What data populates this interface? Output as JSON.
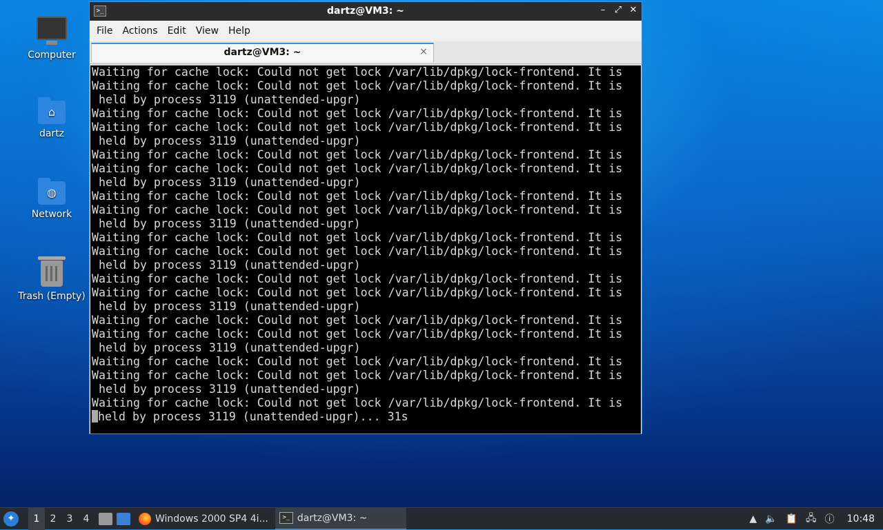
{
  "desktop": {
    "icons": [
      {
        "label": "Computer",
        "icon": "computer-icon"
      },
      {
        "label": "dartz",
        "icon": "home-folder-icon"
      },
      {
        "label": "Network",
        "icon": "network-folder-icon"
      },
      {
        "label": "Trash (Empty)",
        "icon": "trash-icon"
      }
    ]
  },
  "window": {
    "title": "dartz@VM3: ~",
    "controls": {
      "minimize": "–",
      "maximize": "⤢",
      "close": "✕"
    },
    "menu": [
      "File",
      "Actions",
      "Edit",
      "View",
      "Help"
    ],
    "tab": {
      "label": "dartz@VM3: ~",
      "close": "×"
    }
  },
  "terminal": {
    "lines": [
      "Waiting for cache lock: Could not get lock /var/lib/dpkg/lock-frontend. It is",
      "Waiting for cache lock: Could not get lock /var/lib/dpkg/lock-frontend. It is",
      " held by process 3119 (unattended-upgr)",
      "Waiting for cache lock: Could not get lock /var/lib/dpkg/lock-frontend. It is",
      "Waiting for cache lock: Could not get lock /var/lib/dpkg/lock-frontend. It is",
      " held by process 3119 (unattended-upgr)",
      "Waiting for cache lock: Could not get lock /var/lib/dpkg/lock-frontend. It is",
      "Waiting for cache lock: Could not get lock /var/lib/dpkg/lock-frontend. It is",
      " held by process 3119 (unattended-upgr)",
      "Waiting for cache lock: Could not get lock /var/lib/dpkg/lock-frontend. It is",
      "Waiting for cache lock: Could not get lock /var/lib/dpkg/lock-frontend. It is",
      " held by process 3119 (unattended-upgr)",
      "Waiting for cache lock: Could not get lock /var/lib/dpkg/lock-frontend. It is",
      "Waiting for cache lock: Could not get lock /var/lib/dpkg/lock-frontend. It is",
      " held by process 3119 (unattended-upgr)",
      "Waiting for cache lock: Could not get lock /var/lib/dpkg/lock-frontend. It is",
      "Waiting for cache lock: Could not get lock /var/lib/dpkg/lock-frontend. It is",
      " held by process 3119 (unattended-upgr)",
      "Waiting for cache lock: Could not get lock /var/lib/dpkg/lock-frontend. It is",
      "Waiting for cache lock: Could not get lock /var/lib/dpkg/lock-frontend. It is",
      " held by process 3119 (unattended-upgr)",
      "Waiting for cache lock: Could not get lock /var/lib/dpkg/lock-frontend. It is",
      "Waiting for cache lock: Could not get lock /var/lib/dpkg/lock-frontend. It is",
      " held by process 3119 (unattended-upgr)",
      "Waiting for cache lock: Could not get lock /var/lib/dpkg/lock-frontend. It is"
    ],
    "last_line": "held by process 3119 (unattended-upgr)... 31s"
  },
  "taskbar": {
    "start_icon": "start-menu-icon",
    "workspaces": [
      "1",
      "2",
      "3",
      "4"
    ],
    "active_workspace": "1",
    "tasks": [
      {
        "label": "Windows 2000 SP4 4i...",
        "icon": "firefox-icon"
      },
      {
        "label": "dartz@VM3: ~",
        "icon": "terminal-icon"
      }
    ],
    "tray_icons": [
      "up-arrow-icon",
      "volume-icon",
      "clipboard-icon",
      "network-icon",
      "notification-icon"
    ],
    "clock": "10:48"
  },
  "colors": {
    "accent": "#3b8fe0",
    "terminal_bg": "#000000",
    "terminal_fg": "#d9d9d9",
    "taskbar_bg": "#262a30"
  }
}
